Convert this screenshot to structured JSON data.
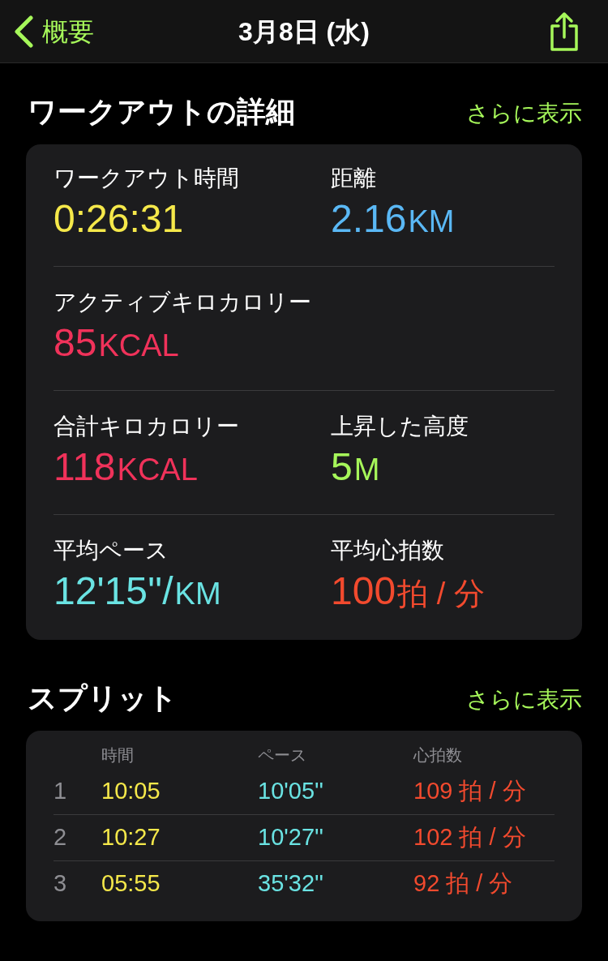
{
  "nav": {
    "back_label": "概要",
    "title": "3月8日 (水)"
  },
  "details": {
    "title": "ワークアウトの詳細",
    "more": "さらに表示",
    "rows": [
      [
        {
          "label": "ワークアウト時間",
          "value": "0:26:31",
          "color": "#f5e84a"
        },
        {
          "label": "距離",
          "value": "2.16",
          "unit": "KM",
          "color": "#5ab8f5"
        }
      ],
      [
        {
          "label": "アクティブキロカロリー",
          "value": "85",
          "unit": "KCAL",
          "color": "#f0325a"
        }
      ],
      [
        {
          "label": "合計キロカロリー",
          "value": "118",
          "unit": "KCAL",
          "color": "#f0325a"
        },
        {
          "label": "上昇した高度",
          "value": "5",
          "unit": "M",
          "color": "#a6f75a"
        }
      ],
      [
        {
          "label": "平均ペース",
          "value": "12'15''/",
          "unit": "KM",
          "color": "#6ae3e3"
        },
        {
          "label": "平均心拍数",
          "value": "100",
          "unit": "拍 / 分",
          "color": "#f24a2e"
        }
      ]
    ]
  },
  "splits": {
    "title": "スプリット",
    "more": "さらに表示",
    "columns": [
      "時間",
      "ペース",
      "心拍数"
    ],
    "rows": [
      {
        "index": "1",
        "time": "10:05",
        "pace": "10'05''",
        "heart_rate": "109 拍 / 分"
      },
      {
        "index": "2",
        "time": "10:27",
        "pace": "10'27''",
        "heart_rate": "102 拍 / 分"
      },
      {
        "index": "3",
        "time": "05:55",
        "pace": "35'32''",
        "heart_rate": "92 拍 / 分"
      }
    ]
  }
}
